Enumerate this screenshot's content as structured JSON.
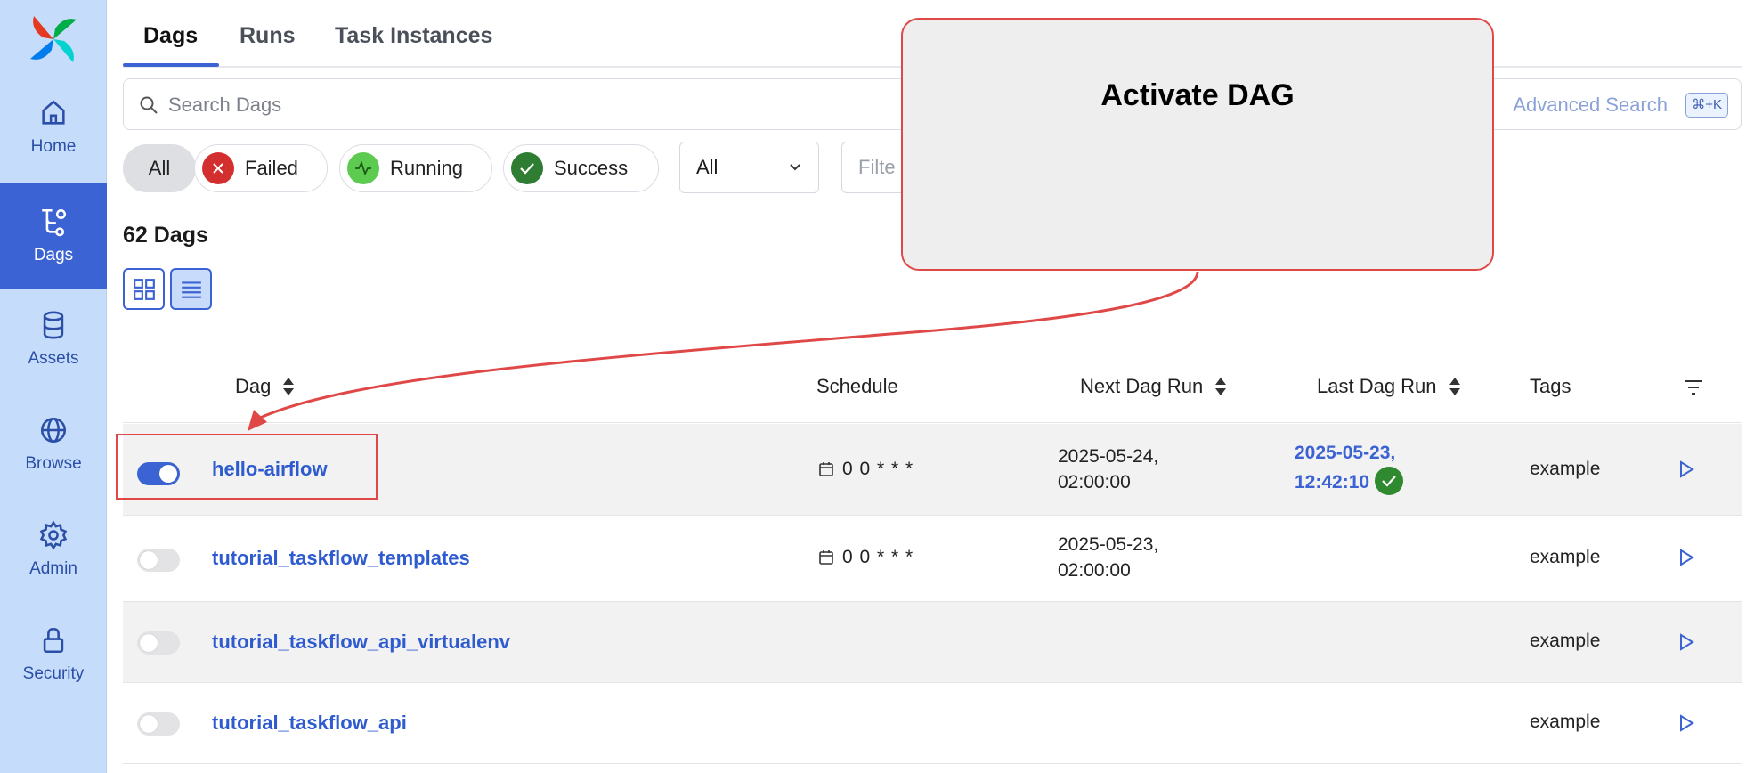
{
  "sidebar": {
    "items": [
      {
        "label": "Home",
        "icon": "home-icon"
      },
      {
        "label": "Dags",
        "icon": "dags-icon"
      },
      {
        "label": "Assets",
        "icon": "database-icon"
      },
      {
        "label": "Browse",
        "icon": "globe-icon"
      },
      {
        "label": "Admin",
        "icon": "gear-icon"
      },
      {
        "label": "Security",
        "icon": "lock-icon"
      }
    ],
    "active": "Dags"
  },
  "tabs": [
    {
      "label": "Dags",
      "active": true
    },
    {
      "label": "Runs",
      "active": false
    },
    {
      "label": "Task Instances",
      "active": false
    }
  ],
  "search": {
    "placeholder": "Search Dags",
    "advanced_label": "Advanced Search",
    "shortcut": "⌘+K"
  },
  "filters": {
    "chips": [
      {
        "label": "All",
        "selected": true
      },
      {
        "label": "Failed",
        "color": "#d32f2f"
      },
      {
        "label": "Running",
        "color": "#5ccb4f"
      },
      {
        "label": "Success",
        "color": "#2e7d32"
      }
    ],
    "select_value": "All",
    "tag_filter_placeholder": "Filte"
  },
  "dag_count": "62 Dags",
  "table": {
    "columns": [
      "Dag",
      "Schedule",
      "Next Dag Run",
      "Last Dag Run",
      "Tags"
    ],
    "rows": [
      {
        "active": true,
        "name": "hello-airflow",
        "schedule": "0 0 * * *",
        "next_run_date": "2025-05-24,",
        "next_run_time": "02:00:00",
        "last_run_date": "2025-05-23,",
        "last_run_time": "12:42:10",
        "last_run_state": "success",
        "tag": "example"
      },
      {
        "active": false,
        "name": "tutorial_taskflow_templates",
        "schedule": "0 0 * * *",
        "next_run_date": "2025-05-23,",
        "next_run_time": "02:00:00",
        "last_run_date": "",
        "last_run_time": "",
        "tag": "example"
      },
      {
        "active": false,
        "name": "tutorial_taskflow_api_virtualenv",
        "schedule": "",
        "next_run_date": "",
        "next_run_time": "",
        "last_run_date": "",
        "last_run_time": "",
        "tag": "example"
      },
      {
        "active": false,
        "name": "tutorial_taskflow_api",
        "schedule": "",
        "next_run_date": "",
        "next_run_time": "",
        "last_run_date": "",
        "last_run_time": "",
        "tag": "example"
      }
    ]
  },
  "annotation": {
    "callout_text": "Activate DAG",
    "color": "#e04848"
  },
  "colors": {
    "accent": "#3c63d3",
    "sidebar": "#c6dcfb",
    "link": "#2f5bd0"
  }
}
